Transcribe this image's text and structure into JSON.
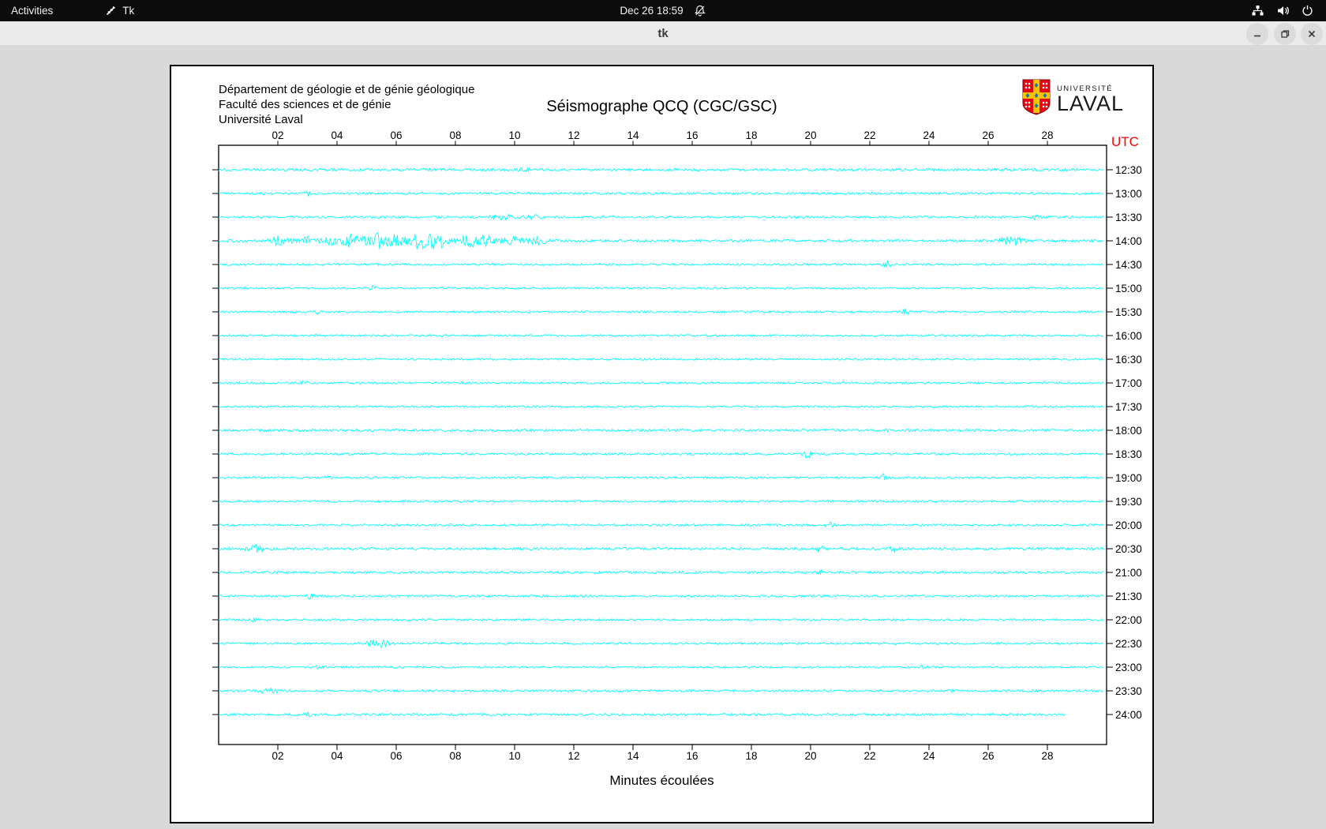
{
  "os_bar": {
    "activities": "Activities",
    "app_menu": "Tk",
    "clock": "Dec 26 18:59"
  },
  "titlebar": {
    "title": "tk"
  },
  "canvas": {
    "header_lines": [
      "Département de géologie et de génie géologique",
      "Faculté des sciences et de génie",
      "Université Laval"
    ],
    "title": "Séismographe QCQ (CGC/GSC)",
    "logo": {
      "line1": "UNIVERSITÉ",
      "line2": "LAVAL"
    },
    "utc_label": "UTC",
    "x_axis_label": "Minutes écoulées"
  },
  "colors": {
    "trace": "#00ffff",
    "utc": "#ff0000",
    "axis": "#000000"
  },
  "chart_data": {
    "type": "line",
    "title": "Séismographe QCQ (CGC/GSC)",
    "xlabel": "Minutes écoulées",
    "x_range": [
      0,
      30
    ],
    "x_ticks": [
      "02",
      "04",
      "06",
      "08",
      "10",
      "12",
      "14",
      "16",
      "18",
      "20",
      "22",
      "24",
      "26",
      "28"
    ],
    "row_spacing_minutes": 30,
    "rows": [
      {
        "label": "12:30",
        "noise": 1.6
      },
      {
        "label": "13:00",
        "noise": 1.4
      },
      {
        "label": "13:30",
        "noise": 1.4
      },
      {
        "label": "14:00",
        "noise": 1.6
      },
      {
        "label": "14:30",
        "noise": 1.3
      },
      {
        "label": "15:00",
        "noise": 1.2
      },
      {
        "label": "15:30",
        "noise": 1.3
      },
      {
        "label": "16:00",
        "noise": 1.3
      },
      {
        "label": "16:30",
        "noise": 1.2
      },
      {
        "label": "17:00",
        "noise": 1.3
      },
      {
        "label": "17:30",
        "noise": 1.2
      },
      {
        "label": "18:00",
        "noise": 1.5
      },
      {
        "label": "18:30",
        "noise": 1.4
      },
      {
        "label": "19:00",
        "noise": 1.3
      },
      {
        "label": "19:30",
        "noise": 1.3
      },
      {
        "label": "20:00",
        "noise": 1.4
      },
      {
        "label": "20:30",
        "noise": 1.6
      },
      {
        "label": "21:00",
        "noise": 1.5
      },
      {
        "label": "21:30",
        "noise": 1.4
      },
      {
        "label": "22:00",
        "noise": 1.3
      },
      {
        "label": "22:30",
        "noise": 1.3
      },
      {
        "label": "23:00",
        "noise": 1.2
      },
      {
        "label": "23:30",
        "noise": 1.4
      },
      {
        "label": "24:00",
        "noise": 1.5,
        "end_minute": 28.6
      }
    ],
    "events": [
      {
        "row": 0,
        "minute": 10.3,
        "amp": 2.0,
        "width": 0.15
      },
      {
        "row": 1,
        "minute": 3.0,
        "amp": 2.2,
        "width": 0.1
      },
      {
        "row": 2,
        "minute": 9.6,
        "amp": 2.8,
        "width": 0.5
      },
      {
        "row": 2,
        "minute": 10.6,
        "amp": 2.4,
        "width": 0.3
      },
      {
        "row": 2,
        "minute": 27.6,
        "amp": 1.8,
        "width": 0.15
      },
      {
        "row": 3,
        "minute": 6.5,
        "amp": 1.5,
        "width": 4.0
      },
      {
        "row": 3,
        "minute": 2.0,
        "amp": 6.0,
        "width": 0.25
      },
      {
        "row": 3,
        "minute": 2.9,
        "amp": 5.0,
        "width": 0.3
      },
      {
        "row": 3,
        "minute": 3.8,
        "amp": 5.0,
        "width": 0.25
      },
      {
        "row": 3,
        "minute": 4.5,
        "amp": 6.0,
        "width": 0.3
      },
      {
        "row": 3,
        "minute": 5.3,
        "amp": 9.0,
        "width": 0.35
      },
      {
        "row": 3,
        "minute": 6.0,
        "amp": 7.0,
        "width": 0.3
      },
      {
        "row": 3,
        "minute": 6.8,
        "amp": 9.0,
        "width": 0.35
      },
      {
        "row": 3,
        "minute": 7.4,
        "amp": 8.0,
        "width": 0.3
      },
      {
        "row": 3,
        "minute": 8.5,
        "amp": 6.0,
        "width": 0.4
      },
      {
        "row": 3,
        "minute": 9.1,
        "amp": 5.0,
        "width": 0.3
      },
      {
        "row": 3,
        "minute": 10.0,
        "amp": 4.0,
        "width": 0.3
      },
      {
        "row": 3,
        "minute": 10.8,
        "amp": 3.5,
        "width": 0.3
      },
      {
        "row": 3,
        "minute": 26.6,
        "amp": 4.0,
        "width": 0.3
      },
      {
        "row": 3,
        "minute": 27.0,
        "amp": 4.0,
        "width": 0.2
      },
      {
        "row": 4,
        "minute": 22.6,
        "amp": 4.0,
        "width": 0.12
      },
      {
        "row": 5,
        "minute": 5.2,
        "amp": 2.5,
        "width": 0.12
      },
      {
        "row": 6,
        "minute": 3.3,
        "amp": 2.5,
        "width": 0.1
      },
      {
        "row": 6,
        "minute": 23.2,
        "amp": 4.0,
        "width": 0.12
      },
      {
        "row": 7,
        "minute": 3.4,
        "amp": 2.0,
        "width": 0.1
      },
      {
        "row": 9,
        "minute": 2.9,
        "amp": 2.5,
        "width": 0.1
      },
      {
        "row": 12,
        "minute": 19.9,
        "amp": 5.0,
        "width": 0.12
      },
      {
        "row": 13,
        "minute": 3.7,
        "amp": 2.0,
        "width": 0.1
      },
      {
        "row": 13,
        "minute": 22.5,
        "amp": 4.0,
        "width": 0.12
      },
      {
        "row": 15,
        "minute": 20.6,
        "amp": 3.5,
        "width": 0.12
      },
      {
        "row": 16,
        "minute": 1.3,
        "amp": 4.0,
        "width": 0.3
      },
      {
        "row": 16,
        "minute": 20.3,
        "amp": 4.0,
        "width": 0.12
      },
      {
        "row": 16,
        "minute": 22.8,
        "amp": 4.0,
        "width": 0.12
      },
      {
        "row": 17,
        "minute": 20.3,
        "amp": 3.0,
        "width": 0.1
      },
      {
        "row": 18,
        "minute": 3.1,
        "amp": 3.0,
        "width": 0.12
      },
      {
        "row": 19,
        "minute": 1.2,
        "amp": 2.0,
        "width": 0.1
      },
      {
        "row": 19,
        "minute": 6.8,
        "amp": 2.0,
        "width": 0.1
      },
      {
        "row": 20,
        "minute": 5.2,
        "amp": 4.0,
        "width": 0.25
      },
      {
        "row": 20,
        "minute": 5.6,
        "amp": 4.0,
        "width": 0.2
      },
      {
        "row": 21,
        "minute": 3.4,
        "amp": 4.0,
        "width": 0.1
      },
      {
        "row": 21,
        "minute": 23.8,
        "amp": 2.0,
        "width": 0.1
      },
      {
        "row": 22,
        "minute": 1.7,
        "amp": 4.0,
        "width": 0.3
      },
      {
        "row": 22,
        "minute": 24.8,
        "amp": 2.5,
        "width": 0.1
      },
      {
        "row": 23,
        "minute": 3.0,
        "amp": 2.0,
        "width": 0.15
      }
    ]
  }
}
